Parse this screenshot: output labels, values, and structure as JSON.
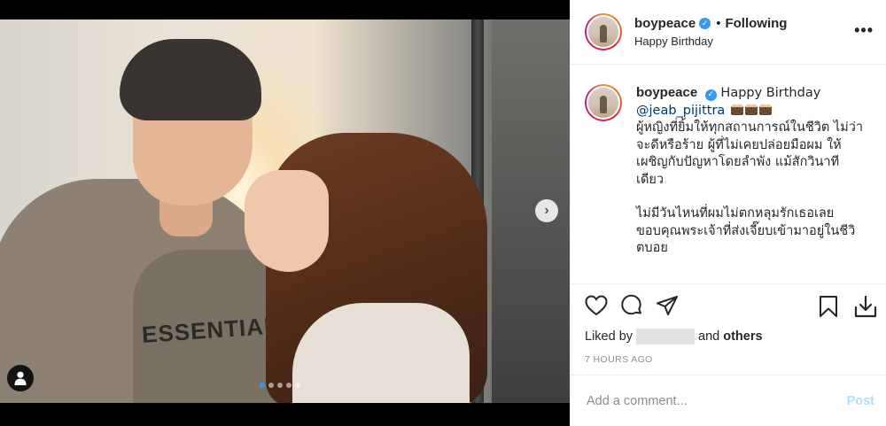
{
  "post": {
    "username": "boypeace",
    "follow_status": "Following",
    "location": "Happy Birthday",
    "caption": {
      "username": "boypeace",
      "text_start": "Happy Birthday",
      "mention": "@jeab_pijittra",
      "paragraph1": "ผู้หญิงที่ยิ้มให้ทุกสถานการณ์ในชีวิต ไม่ว่าจะดีหรือร้าย ผู้ที่ไม่เคยปล่อยมือผม ให้เผชิญกับปัญหาโดยลำพัง แม้สักวินาทีเดียว",
      "paragraph2": "ไม่มีวันไหนที่ผมไม่ตกหลุมรักเธอเลย ขอบคุณพระเจ้าที่ส่งเจี๊ยบเข้ามาอยู่ในชีวิตบอย"
    },
    "image_text": "ESSENTIALS",
    "carousel": {
      "total": 5,
      "active_index": 0
    },
    "likes": {
      "prefix": "Liked by",
      "suffix_and": "and",
      "suffix_others": "others"
    },
    "timestamp": "7 HOURS AGO",
    "comment": {
      "placeholder": "Add a comment...",
      "post_label": "Post"
    }
  },
  "icons": {
    "verified": "verified-badge-icon",
    "more": "more-options-icon",
    "like": "heart-icon",
    "comment": "comment-icon",
    "share": "send-icon",
    "save": "bookmark-icon",
    "download": "download-icon",
    "next": "chevron-right-icon",
    "tags": "user-tag-icon"
  },
  "colors": {
    "accent": "#3897f0",
    "post_disabled": "#b2dffc",
    "mention": "#003569"
  }
}
